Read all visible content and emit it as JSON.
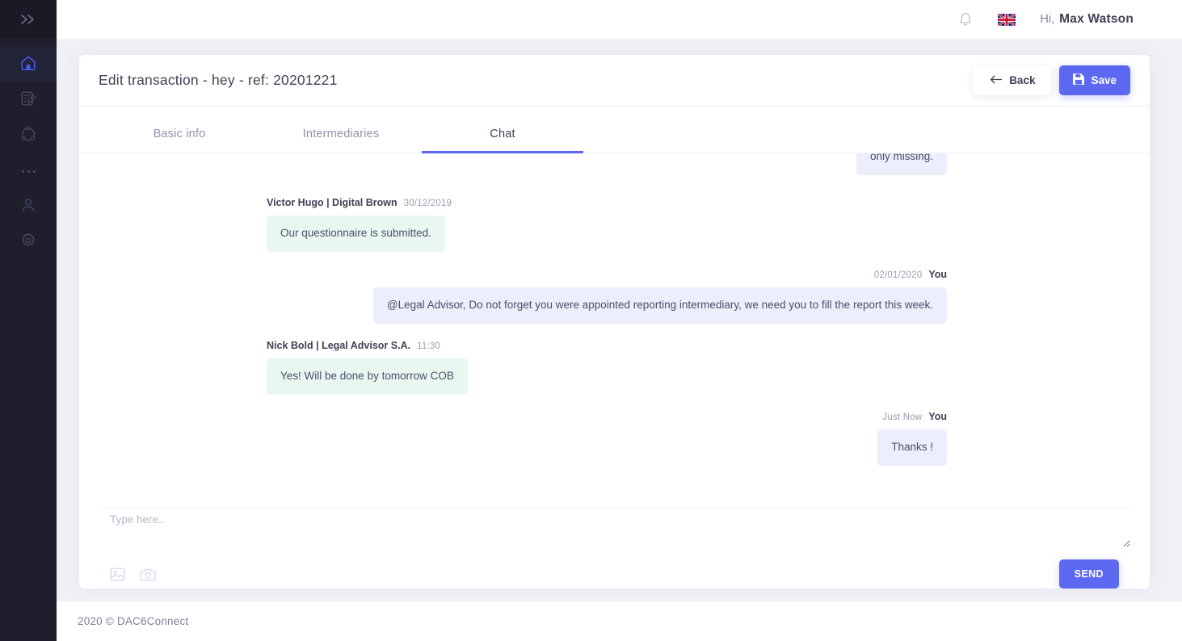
{
  "sidebar": {
    "collapse_icon": "chevron-double-right-icon",
    "items": [
      {
        "icon": "home-icon",
        "active": true
      },
      {
        "icon": "form-edit-icon",
        "active": false
      },
      {
        "icon": "network-share-icon",
        "active": false
      },
      {
        "icon": "ellipsis-icon",
        "active": false
      },
      {
        "icon": "user-icon",
        "active": false
      },
      {
        "icon": "gear-icon",
        "active": false
      }
    ]
  },
  "topbar": {
    "notification_icon": "bell-icon",
    "language_flag": "uk-flag-icon",
    "greeting": "Hi,",
    "user_name": "Max Watson"
  },
  "header": {
    "title": "Edit transaction - hey - ref: 20201221",
    "back_label": "Back",
    "back_icon": "arrow-left-icon",
    "save_label": "Save",
    "save_icon": "floppy-save-icon"
  },
  "tabs": [
    {
      "label": "Basic info",
      "active": false
    },
    {
      "label": "Intermediaries",
      "active": false
    },
    {
      "label": "Chat",
      "active": true
    }
  ],
  "chat": {
    "partial_message": {
      "text": "only missing.",
      "side": "right"
    },
    "messages": [
      {
        "author": "Victor Hugo | Digital Brown",
        "time": "30/12/2019",
        "text": "Our questionnaire is submitted.",
        "side": "left"
      },
      {
        "author": "You",
        "time": "02/01/2020",
        "text": "@Legal Advisor, Do not forget you were appointed reporting intermediary, we need you to fill the report this week.",
        "side": "right"
      },
      {
        "author": "Nick Bold | Legal Advisor S.A.",
        "time": "11:30",
        "text": "Yes! Will be done by tomorrow COB",
        "side": "left"
      },
      {
        "author": "You",
        "time": "Just Now",
        "text": "Thanks !",
        "side": "right"
      }
    ],
    "composer": {
      "placeholder": "Type here..",
      "value": "",
      "image_icon": "image-attachment-icon",
      "camera_icon": "camera-icon",
      "send_label": "SEND"
    }
  },
  "footer": {
    "copyright": "2020 © DAC6Connect"
  },
  "colors": {
    "accent": "#5d68f0",
    "sidebar_bg": "#1e1e2d",
    "page_bg": "#f0f1f7",
    "bubble_in": "#e9f7f1",
    "bubble_out": "#eceefc",
    "text_dark": "#3f4254",
    "text_muted": "#8e93a8"
  }
}
